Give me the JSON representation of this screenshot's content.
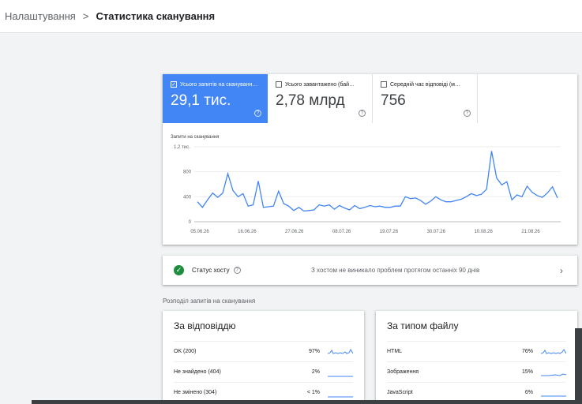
{
  "breadcrumb": {
    "parent": "Налаштування",
    "separator": ">",
    "current": "Статистика сканування"
  },
  "metrics": [
    {
      "label": "Усього запитів на скануванн…",
      "value": "29,1 тис.",
      "checked": true
    },
    {
      "label": "Усього завантажено (бай…",
      "value": "2,78 млрд",
      "checked": false
    },
    {
      "label": "Середній час відповіді (м…",
      "value": "756",
      "checked": false
    }
  ],
  "chart_title": "Запити на сканування",
  "chart_data": {
    "type": "line",
    "ylabel": "Запити на сканування",
    "ylim": [
      0,
      1200
    ],
    "yticks": [
      "1,2 тис.",
      "800",
      "400",
      "0"
    ],
    "x_tick_labels": [
      "05.06.26",
      "16.06.26",
      "27.06.26",
      "08.07.26",
      "19.07.26",
      "30.07.26",
      "10.08.26",
      "21.08.26"
    ],
    "series": [
      {
        "values": [
          320,
          230,
          350,
          460,
          390,
          460,
          770,
          500,
          400,
          450,
          250,
          270,
          650,
          230,
          240,
          250,
          490,
          290,
          250,
          180,
          230,
          170,
          180,
          190,
          270,
          250,
          270,
          200,
          260,
          220,
          190,
          260,
          210,
          230,
          260,
          240,
          250,
          230,
          230,
          250,
          250,
          400,
          370,
          380,
          340,
          280,
          330,
          400,
          350,
          320,
          320,
          340,
          360,
          400,
          450,
          420,
          440,
          520,
          1130,
          700,
          590,
          640,
          350,
          430,
          400,
          570,
          470,
          420,
          390,
          460,
          560,
          380
        ]
      }
    ],
    "color": "#4285f4"
  },
  "host_status": {
    "label": "Статус хосту",
    "text": "З хостом не виникало проблем протягом останніх 90 днів"
  },
  "breakdown_title": "Розподіл запитів на сканування",
  "by_response": {
    "title": "За відповіддю",
    "rows": [
      {
        "name": "OK (200)",
        "pct": "97%"
      },
      {
        "name": "Не знайдено (404)",
        "pct": "2%"
      },
      {
        "name": "Не змінено (304)",
        "pct": "< 1%"
      }
    ]
  },
  "by_filetype": {
    "title": "За типом файлу",
    "rows": [
      {
        "name": "HTML",
        "pct": "76%"
      },
      {
        "name": "Зображення",
        "pct": "15%"
      },
      {
        "name": "JavaScript",
        "pct": "6%"
      }
    ]
  }
}
